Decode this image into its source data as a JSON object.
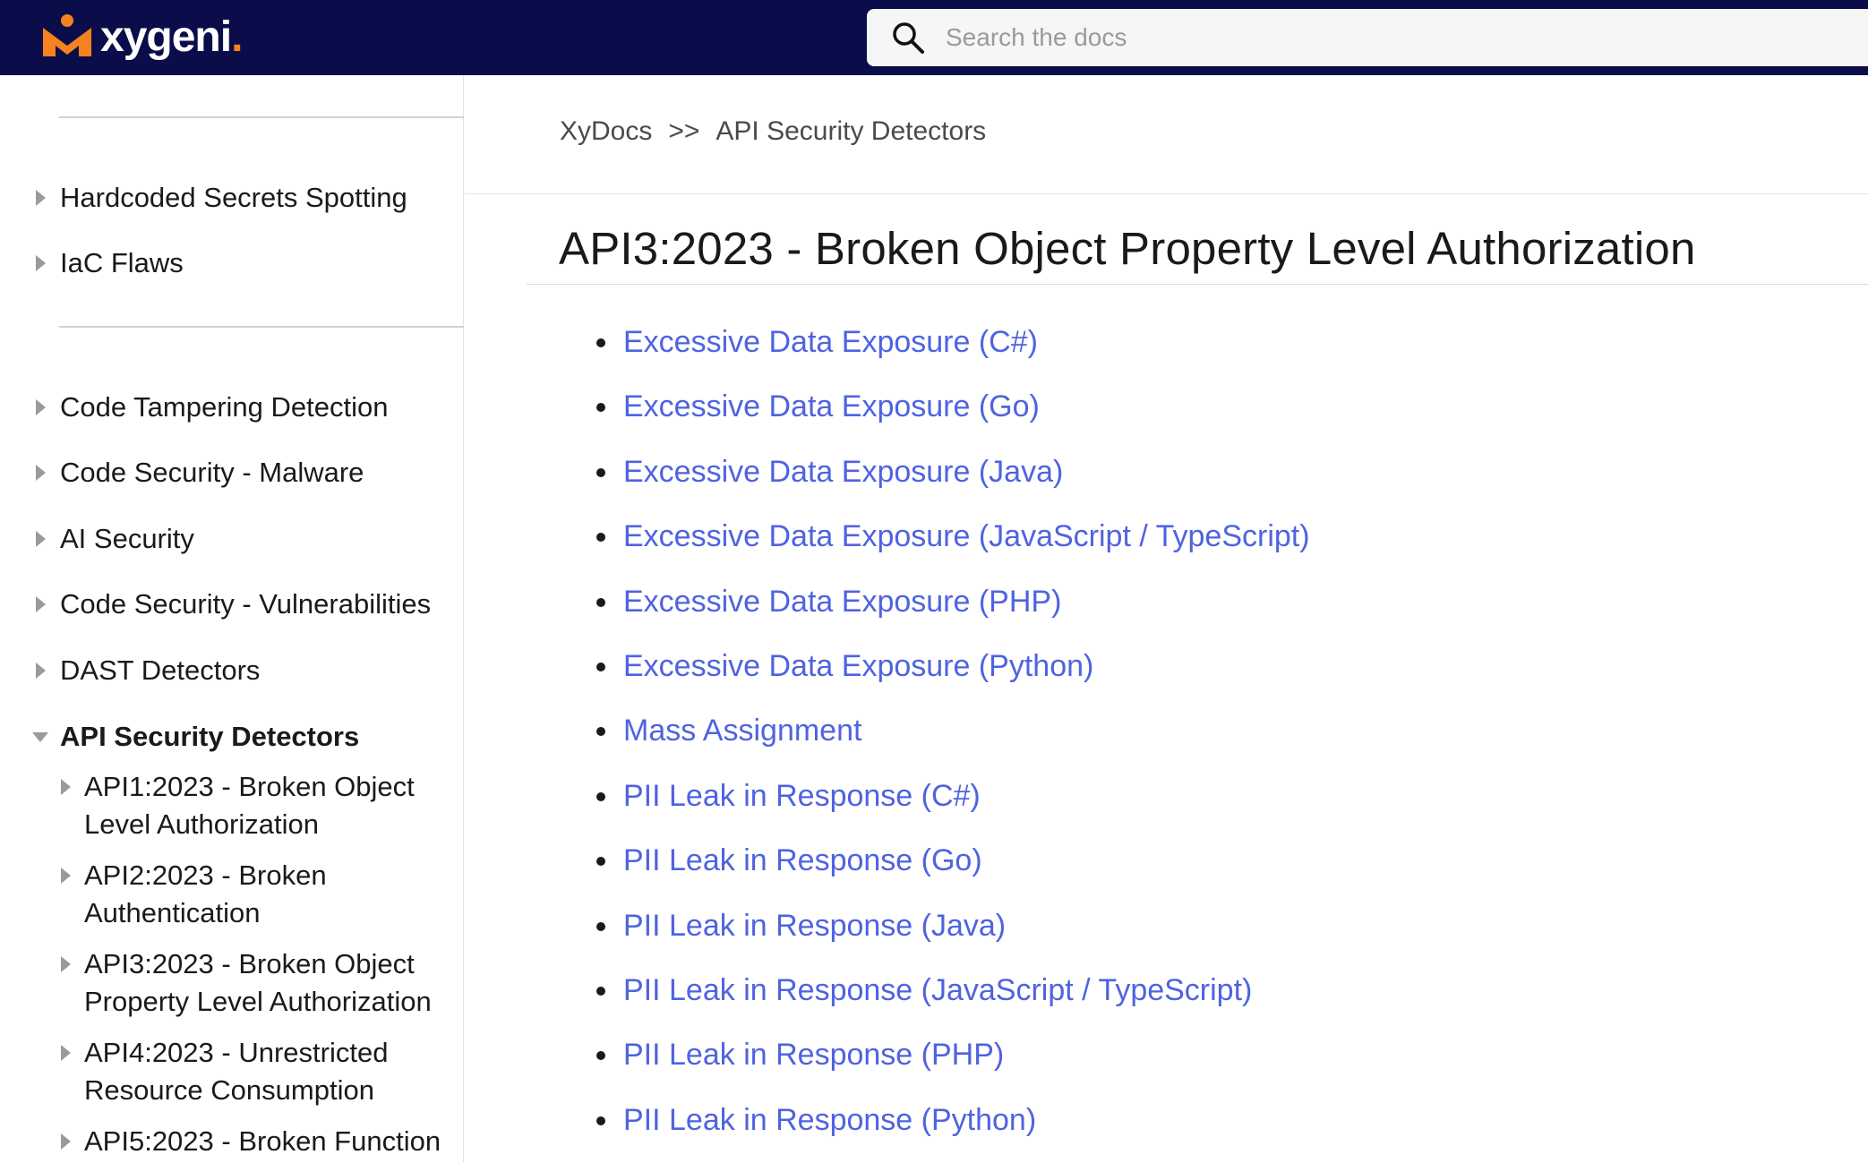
{
  "header": {
    "brand": "xygeni",
    "brand_dot": ".",
    "search_placeholder": "Search the docs",
    "colors": {
      "bar": "#0b0d4a",
      "accent": "#f58220",
      "link": "#4f63e0"
    }
  },
  "sidebar": {
    "group1": [
      "Hardcoded Secrets Spotting",
      "IaC Flaws"
    ],
    "group2": [
      "Code Tampering Detection",
      "Code Security - Malware",
      "AI Security",
      "Code Security - Vulnerabilities",
      "DAST Detectors"
    ],
    "active": "API Security Detectors",
    "sub_items": [
      [
        "API1:2023 - Broken Object",
        "Level Authorization"
      ],
      [
        "API2:2023 - Broken",
        "Authentication"
      ],
      [
        "API3:2023 - Broken Object",
        "Property Level Authorization"
      ],
      [
        "API4:2023 - Unrestricted",
        "Resource Consumption"
      ],
      [
        "API5:2023 - Broken Function",
        ""
      ]
    ]
  },
  "breadcrumb": {
    "root": "XyDocs",
    "sep": ">>",
    "current": "API Security Detectors"
  },
  "main": {
    "title": "API3:2023 - Broken Object Property Level Authorization",
    "links": [
      "Excessive Data Exposure (C#)",
      "Excessive Data Exposure (Go)",
      "Excessive Data Exposure (Java)",
      "Excessive Data Exposure (JavaScript / TypeScript)",
      "Excessive Data Exposure (PHP)",
      "Excessive Data Exposure (Python)",
      "Mass Assignment",
      "PII Leak in Response (C#)",
      "PII Leak in Response (Go)",
      "PII Leak in Response (Java)",
      "PII Leak in Response (JavaScript / TypeScript)",
      "PII Leak in Response (PHP)",
      "PII Leak in Response (Python)"
    ]
  }
}
